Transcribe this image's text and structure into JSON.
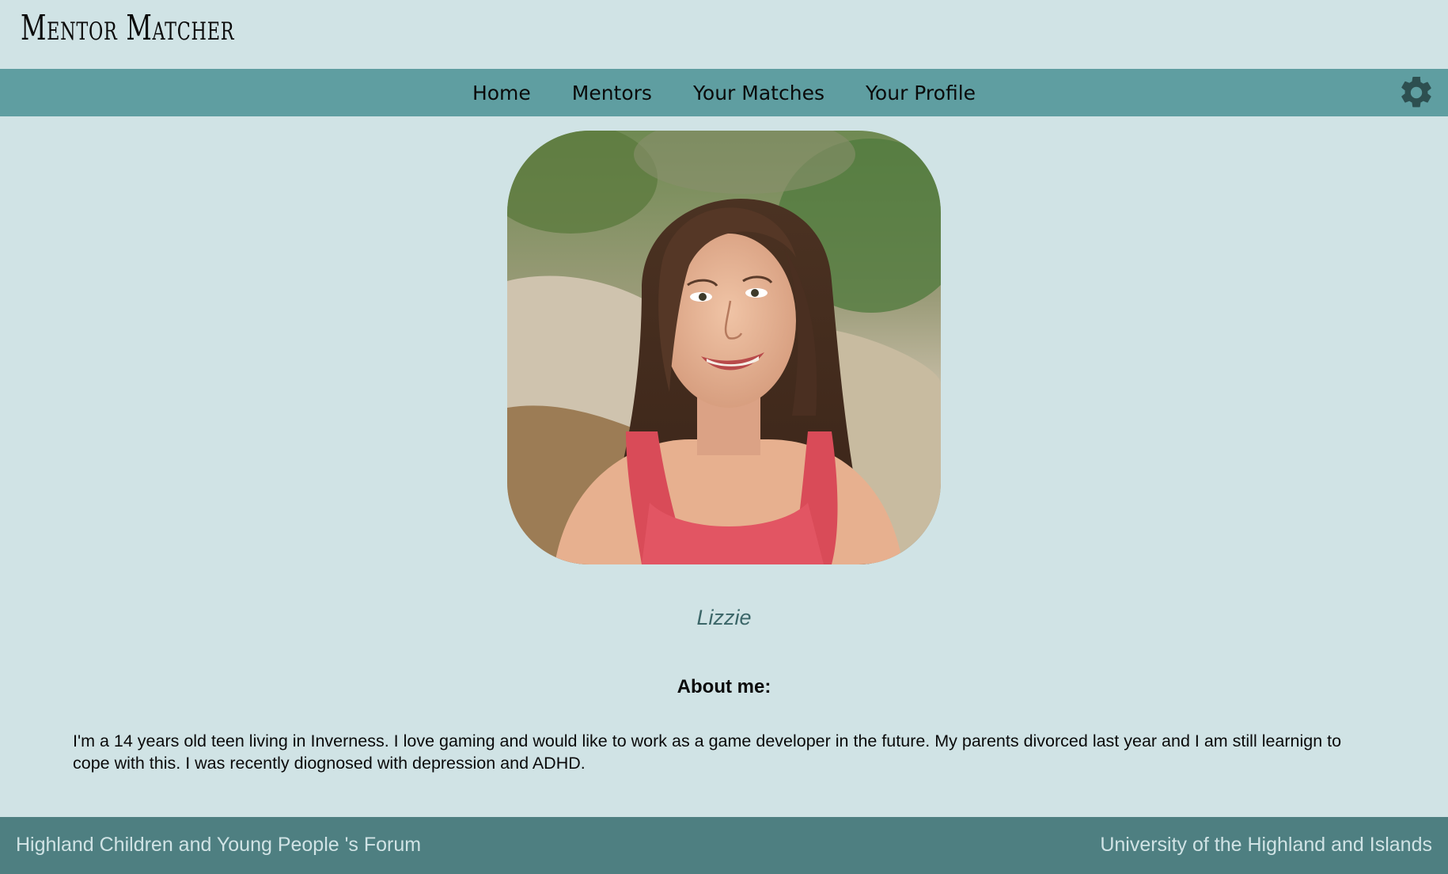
{
  "app": {
    "title": "Mentor Matcher"
  },
  "nav": {
    "items": [
      {
        "label": "Home"
      },
      {
        "label": "Mentors"
      },
      {
        "label": "Your Matches"
      },
      {
        "label": "Your Profile"
      }
    ],
    "settings_icon": "gear-icon"
  },
  "profile": {
    "photo_icon": "profile-photo",
    "name": "Lizzie",
    "about_heading": "About me:",
    "about_text": "I'm a 14 years old teen living in Inverness. I love gaming and would like to work as a game developer in the future. My parents divorced last year and I am still learnign to cope with this. I was recently diognosed with depression and ADHD."
  },
  "footer": {
    "left": "Highland Children and Young People 's Forum",
    "right": "University of the Highland and Islands"
  },
  "colors": {
    "background": "#d0e3e5",
    "nav": "#5f9ea1",
    "footer": "#4e7f81",
    "name_accent": "#3b6668"
  }
}
